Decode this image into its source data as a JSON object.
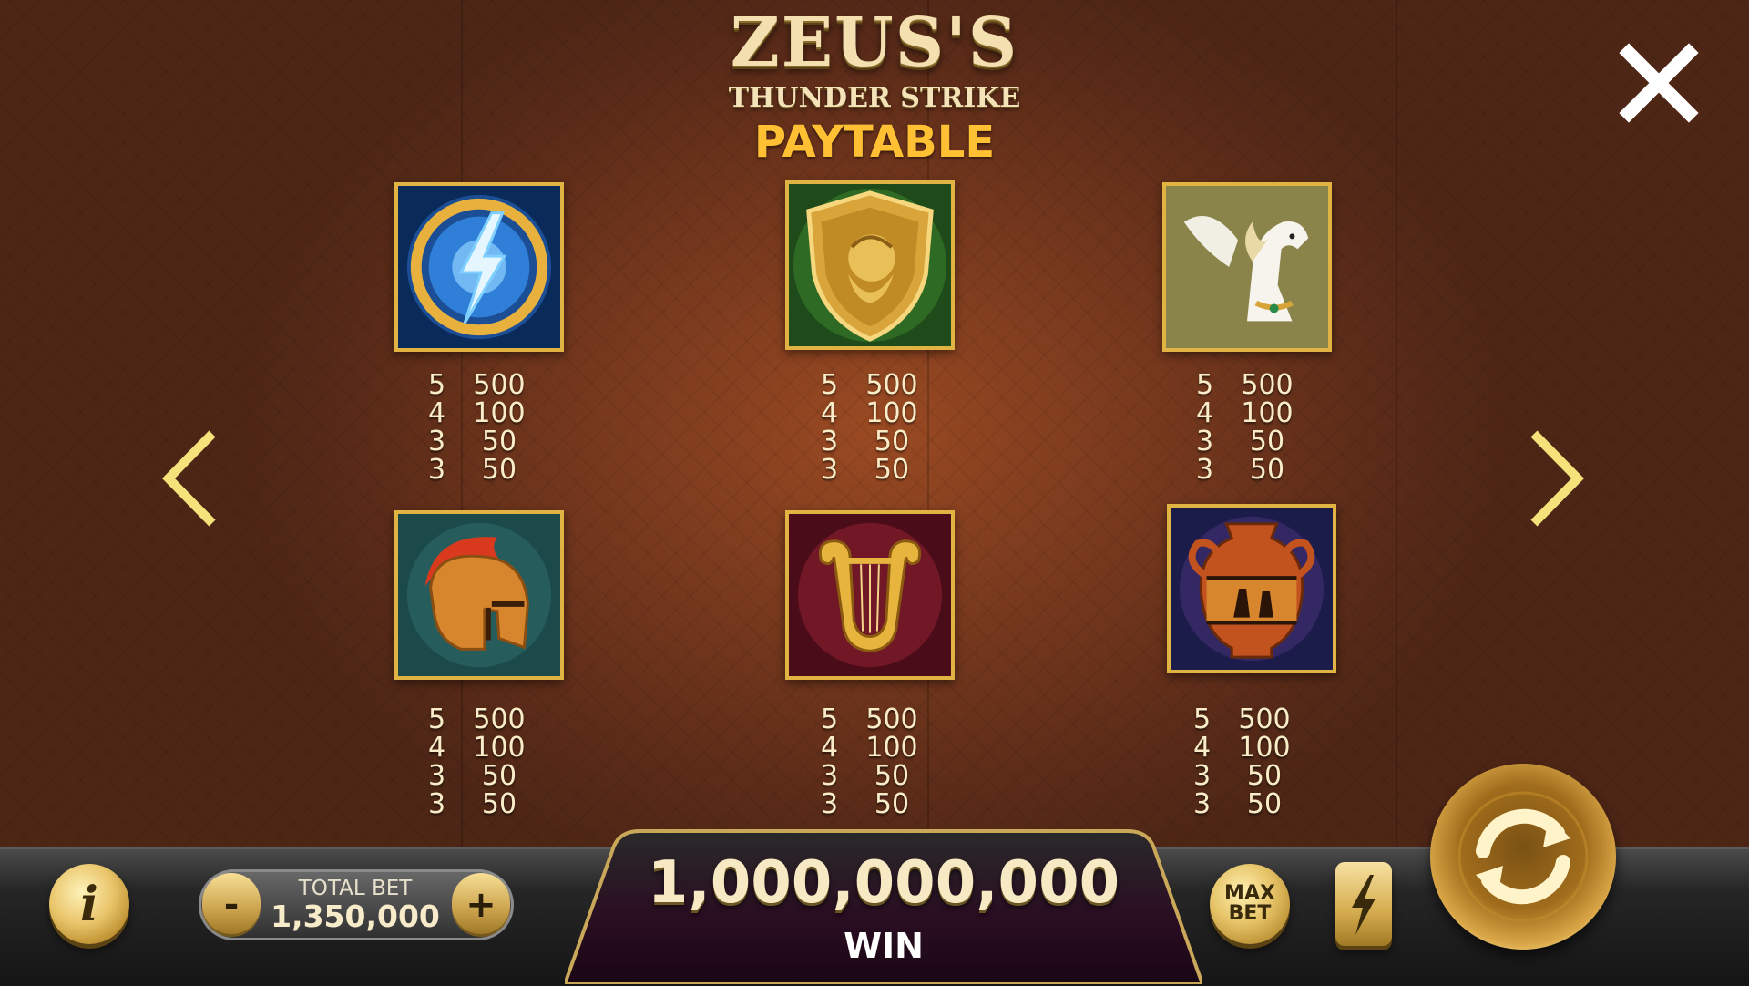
{
  "header": {
    "logo_title": "ZEUS'S",
    "logo_subtitle": "THUNDER STRIKE",
    "page_title": "PAYTABLE"
  },
  "navigation": {
    "close_icon": "close-icon",
    "prev_icon": "chevron-left-icon",
    "next_icon": "chevron-right-icon"
  },
  "symbols": [
    {
      "icon": "lightning-coin-icon",
      "pays": [
        {
          "count": "5",
          "amount": "500"
        },
        {
          "count": "4",
          "amount": "100"
        },
        {
          "count": "3",
          "amount": "50"
        },
        {
          "count": "3",
          "amount": "50"
        }
      ]
    },
    {
      "icon": "zeus-shield-icon",
      "pays": [
        {
          "count": "5",
          "amount": "500"
        },
        {
          "count": "4",
          "amount": "100"
        },
        {
          "count": "3",
          "amount": "50"
        },
        {
          "count": "3",
          "amount": "50"
        }
      ]
    },
    {
      "icon": "pegasus-icon",
      "pays": [
        {
          "count": "5",
          "amount": "500"
        },
        {
          "count": "4",
          "amount": "100"
        },
        {
          "count": "3",
          "amount": "50"
        },
        {
          "count": "3",
          "amount": "50"
        }
      ]
    },
    {
      "icon": "spartan-helmet-icon",
      "pays": [
        {
          "count": "5",
          "amount": "500"
        },
        {
          "count": "4",
          "amount": "100"
        },
        {
          "count": "3",
          "amount": "50"
        },
        {
          "count": "3",
          "amount": "50"
        }
      ]
    },
    {
      "icon": "golden-lyre-icon",
      "pays": [
        {
          "count": "5",
          "amount": "500"
        },
        {
          "count": "4",
          "amount": "100"
        },
        {
          "count": "3",
          "amount": "50"
        },
        {
          "count": "3",
          "amount": "50"
        }
      ]
    },
    {
      "icon": "greek-amphora-icon",
      "pays": [
        {
          "count": "5",
          "amount": "500"
        },
        {
          "count": "4",
          "amount": "100"
        },
        {
          "count": "3",
          "amount": "50"
        },
        {
          "count": "3",
          "amount": "50"
        }
      ]
    }
  ],
  "bottom_bar": {
    "info_label": "i",
    "bet_minus": "-",
    "bet_plus": "+",
    "total_bet_label": "TOTAL BET",
    "total_bet_value": "1,350,000",
    "win_value": "1,000,000,000",
    "win_label": "WIN",
    "max_bet_line1": "MAX",
    "max_bet_line2": "BET",
    "turbo_icon": "lightning-icon",
    "spin_icon": "refresh-icon"
  },
  "colors": {
    "accent_gold": "#e1b343",
    "title_orange": "#ffc133",
    "background_brown": "#7a3a1e"
  }
}
